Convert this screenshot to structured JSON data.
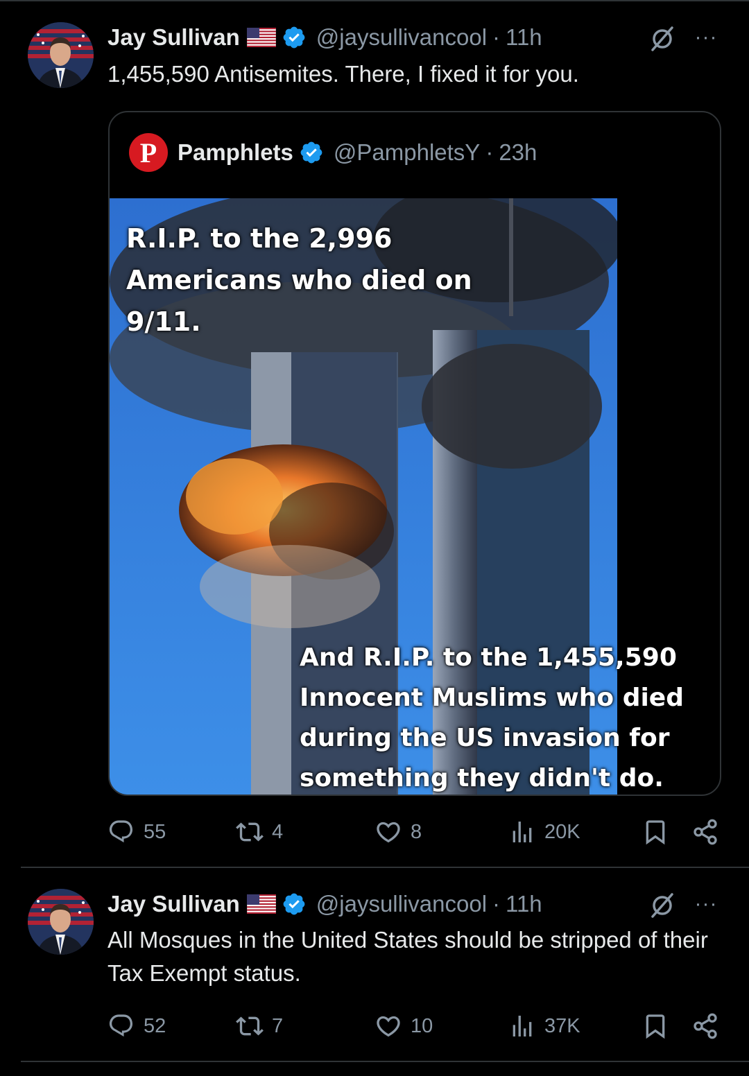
{
  "posts": [
    {
      "author": {
        "name": "Jay Sullivan",
        "handle": "@jaysullivancool",
        "time": "11h"
      },
      "text": "1,455,590 Antisemites. There, I fixed it for you.",
      "quote": {
        "author": {
          "name": "Pamphlets",
          "handle": "@PamphletsY",
          "time": "23h",
          "logo_letter": "P"
        },
        "image": {
          "caption_top": "R.I.P. to the 2,996 Americans who died on 9/11.",
          "caption_bottom": "And R.I.P. to the 1,455,590 Innocent Muslims who died during the US invasion for something they didn't do."
        }
      },
      "stats": {
        "replies": "55",
        "reposts": "4",
        "likes": "8",
        "views": "20K"
      }
    },
    {
      "author": {
        "name": "Jay Sullivan",
        "handle": "@jaysullivancool",
        "time": "11h"
      },
      "text": "All Mosques in the United States should be stripped of their Tax Exempt status.",
      "stats": {
        "replies": "52",
        "reposts": "7",
        "likes": "10",
        "views": "37K"
      }
    }
  ],
  "ui": {
    "separator_dot": "·",
    "more_icon": "···"
  },
  "icons": [
    "us-flag-icon",
    "verified-badge-icon",
    "grok-icon",
    "more-icon",
    "reply-icon",
    "repost-icon",
    "like-icon",
    "views-icon",
    "bookmark-icon",
    "share-icon"
  ],
  "colors": {
    "background": "#000000",
    "text": "#e7e9ea",
    "muted": "#8b98a5",
    "verified": "#1d9bf0",
    "border": "#2f3336",
    "pamphlets_red": "#d71a21"
  }
}
